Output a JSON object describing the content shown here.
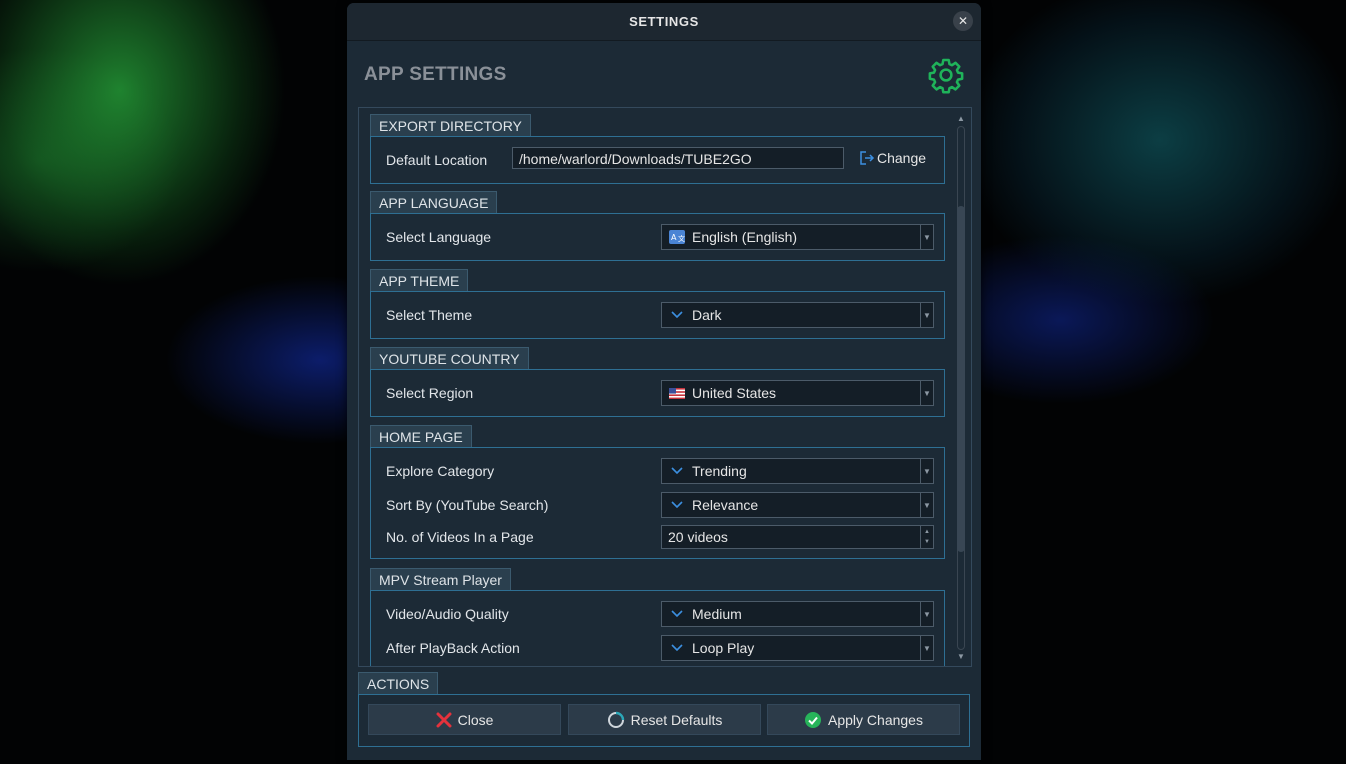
{
  "window": {
    "title": "SETTINGS",
    "close_glyph": "✕"
  },
  "header": {
    "title": "APP SETTINGS",
    "icon": "gear-icon",
    "icon_color": "#1fb35a"
  },
  "sections": {
    "export": {
      "label": "EXPORT DIRECTORY",
      "row_label": "Default Location",
      "path_value": "/home/warlord/Downloads/TUBE2GO",
      "change_label": "Change"
    },
    "language": {
      "label": "APP LANGUAGE",
      "row_label": "Select Language",
      "value": "English (English)",
      "icon": "translate-icon"
    },
    "theme": {
      "label": "APP THEME",
      "row_label": "Select Theme",
      "value": "Dark",
      "icon": "chevron-down-icon"
    },
    "country": {
      "label": "YOUTUBE COUNTRY",
      "row_label": "Select Region",
      "value": "United States",
      "icon": "us-flag-icon"
    },
    "home": {
      "label": "HOME PAGE",
      "rows": [
        {
          "label": "Explore Category",
          "value": "Trending"
        },
        {
          "label": "Sort By (YouTube Search)",
          "value": "Relevance"
        },
        {
          "label": "No. of Videos In a Page",
          "value": "20 videos"
        }
      ]
    },
    "mpv": {
      "label": "MPV Stream Player",
      "rows": [
        {
          "label": "Video/Audio Quality",
          "value": "Medium"
        },
        {
          "label": "After PlayBack Action",
          "value": "Loop Play"
        }
      ]
    }
  },
  "actions": {
    "label": "ACTIONS",
    "close_label": "Close",
    "reset_label": "Reset Defaults",
    "apply_label": "Apply Changes",
    "close_color": "#e5323c",
    "apply_color": "#27b45a"
  },
  "colors": {
    "accent_border": "#2e6f93",
    "panel_bg": "#1c2a36",
    "label_tab_bg": "#2a3f4e"
  }
}
